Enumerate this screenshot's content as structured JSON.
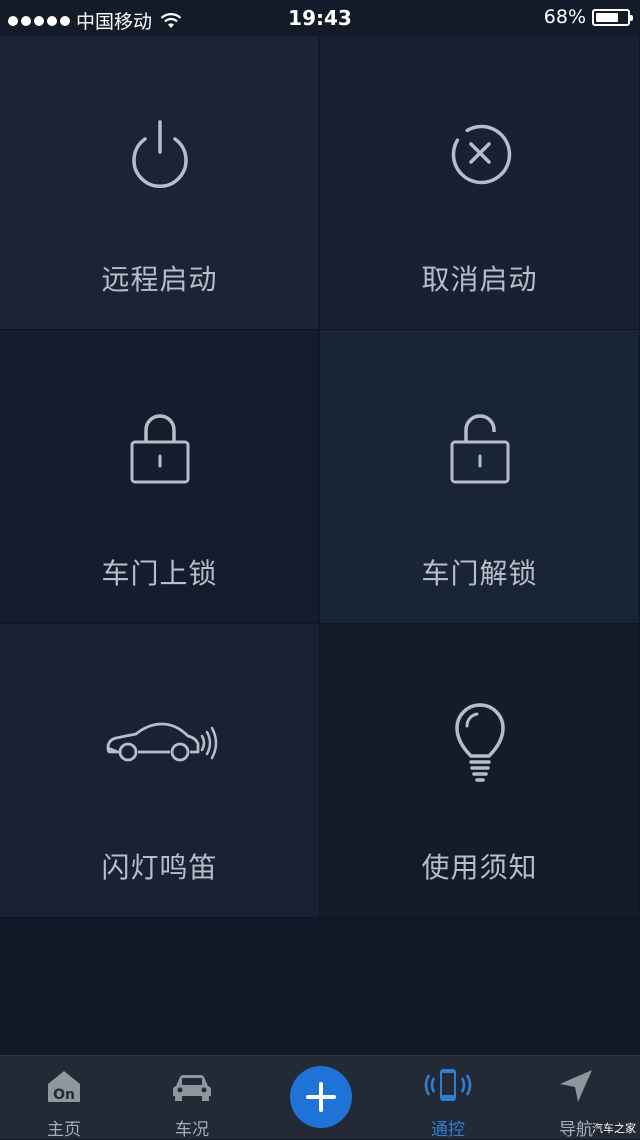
{
  "status_bar": {
    "carrier": "中国移动",
    "time": "19:43",
    "battery": "68%"
  },
  "tiles": [
    {
      "label": "远程启动",
      "icon": "power-icon"
    },
    {
      "label": "取消启动",
      "icon": "cancel-circle-icon"
    },
    {
      "label": "车门上锁",
      "icon": "lock-closed-icon"
    },
    {
      "label": "车门解锁",
      "icon": "lock-open-icon"
    },
    {
      "label": "闪灯鸣笛",
      "icon": "car-horn-icon"
    },
    {
      "label": "使用须知",
      "icon": "lightbulb-icon"
    }
  ],
  "tab_bar": {
    "items": [
      {
        "label": "主页",
        "icon": "home-on-icon"
      },
      {
        "label": "车况",
        "icon": "car-icon"
      },
      {
        "label": "",
        "icon": "plus-icon"
      },
      {
        "label": "通控",
        "icon": "phone-remote-icon"
      },
      {
        "label": "导航",
        "icon": "navigation-arrow-icon"
      }
    ],
    "active": "通控",
    "active_color": "#2f7fd6"
  },
  "watermark": "汽车之家"
}
